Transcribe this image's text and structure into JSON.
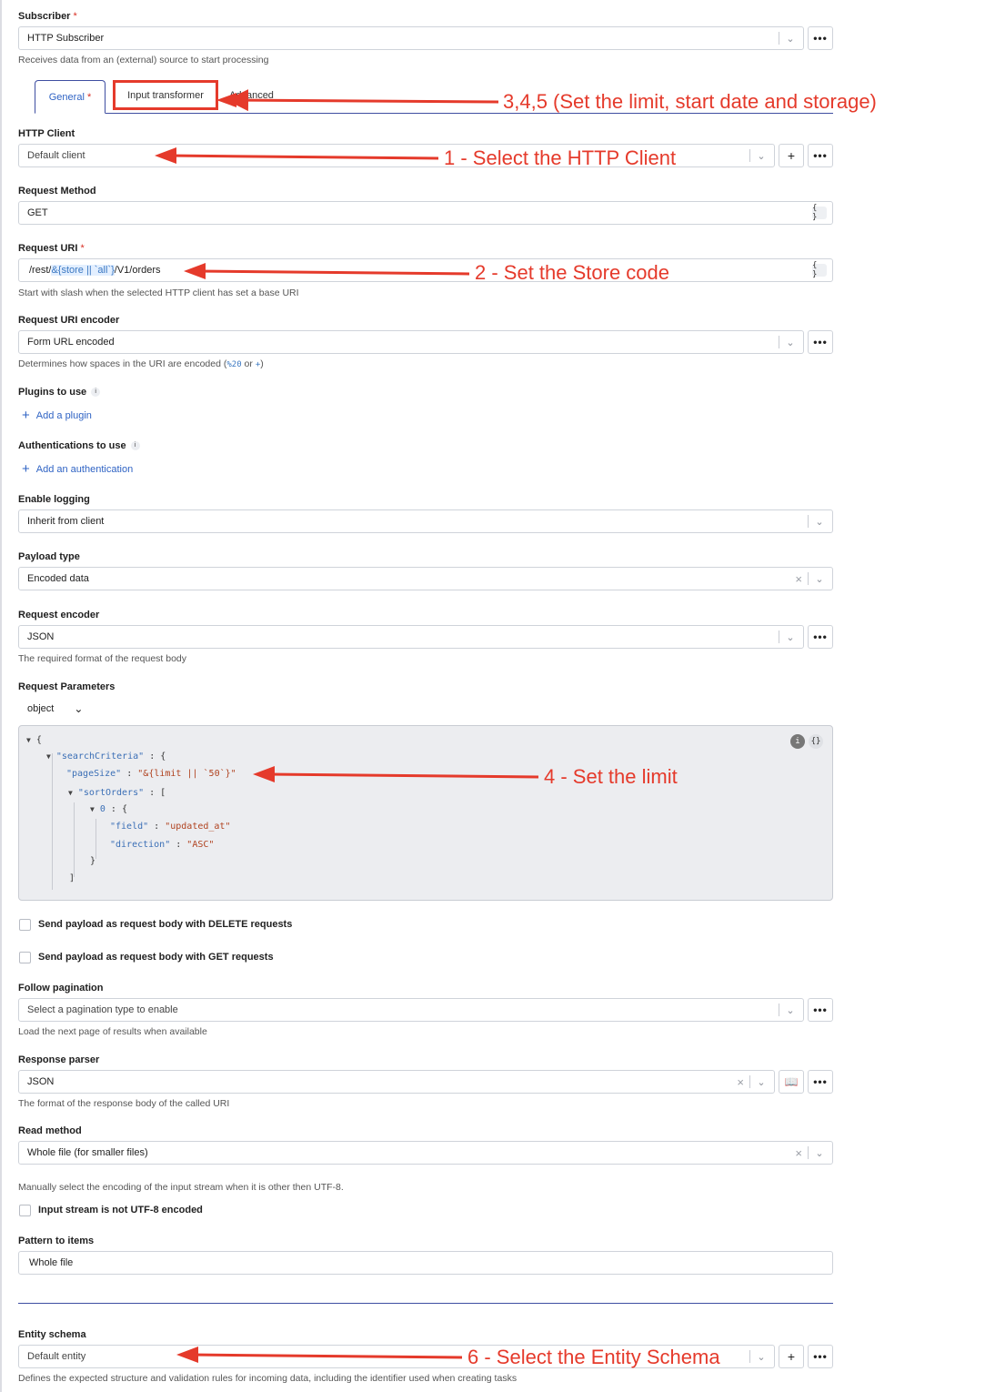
{
  "subscriber": {
    "label": "Subscriber",
    "required_mark": "*",
    "value": "HTTP Subscriber",
    "help": "Receives data from an (external) source to start processing"
  },
  "tabs": [
    {
      "label": "General",
      "required_mark": "*"
    },
    {
      "label": "Input transformer"
    },
    {
      "label": "Advanced"
    }
  ],
  "http_client": {
    "label": "HTTP Client",
    "value": "Default client"
  },
  "request_method": {
    "label": "Request Method",
    "value": "GET"
  },
  "request_uri": {
    "label": "Request URI",
    "required_mark": "*",
    "prefix": "/rest/",
    "expr": "&{store || `all`}",
    "suffix": "/V1/orders",
    "help": "Start with slash when the selected HTTP client has set a base URI"
  },
  "uri_encoder": {
    "label": "Request URI encoder",
    "value": "Form URL encoded",
    "help_pre": "Determines how spaces in the URI are encoded (",
    "help_code1": "%20",
    "help_mid": " or ",
    "help_code2": "+",
    "help_post": ")"
  },
  "plugins": {
    "label": "Plugins to use",
    "add": "Add a plugin"
  },
  "auth": {
    "label": "Authentications to use",
    "add": "Add an authentication"
  },
  "logging": {
    "label": "Enable logging",
    "value": "Inherit from client"
  },
  "payload_type": {
    "label": "Payload type",
    "value": "Encoded data"
  },
  "request_encoder": {
    "label": "Request encoder",
    "value": "JSON",
    "help": "The required format of the request body"
  },
  "request_params": {
    "label": "Request Parameters",
    "type": "object",
    "code": {
      "open": "{",
      "searchCriteria_key": "\"searchCriteria\"",
      "pageSize_key": "\"pageSize\"",
      "pageSize_val": "\"&{limit || `50`}\"",
      "sortOrders_key": "\"sortOrders\"",
      "index_key": "0",
      "field_key": "\"field\"",
      "field_val": "\"updated_at\"",
      "direction_key": "\"direction\"",
      "direction_val": "\"ASC\"",
      "close_obj": "}",
      "close_arr": "]"
    }
  },
  "checkbox_delete": "Send payload as request body with DELETE requests",
  "checkbox_get": "Send payload as request body with GET requests",
  "pagination": {
    "label": "Follow pagination",
    "placeholder": "Select a pagination type to enable",
    "help": "Load the next page of results when available"
  },
  "response_parser": {
    "label": "Response parser",
    "value": "JSON",
    "help": "The format of the response body of the called URI"
  },
  "read_method": {
    "label": "Read method",
    "value": "Whole file (for smaller files)",
    "help": "Manually select the encoding of the input stream when it is other then UTF-8."
  },
  "checkbox_utf8": "Input stream is not UTF-8 encoded",
  "pattern": {
    "label": "Pattern to items",
    "value": "Whole file"
  },
  "entity_schema": {
    "label": "Entity schema",
    "value": "Default entity",
    "help": "Defines the expected structure and validation rules for incoming data, including the identifier used when creating tasks"
  },
  "annotations": {
    "a1": "1 - Select the HTTP Client",
    "a2": "2 - Set the Store code",
    "a345": "3,4,5 (Set the limit, start date and storage)",
    "a4": "4 -  Set the limit",
    "a6": "6 - Select the Entity Schema"
  },
  "colors": {
    "accent": "#3e4ea1",
    "link": "#2f63c4",
    "annotation": "#e53a2b"
  }
}
